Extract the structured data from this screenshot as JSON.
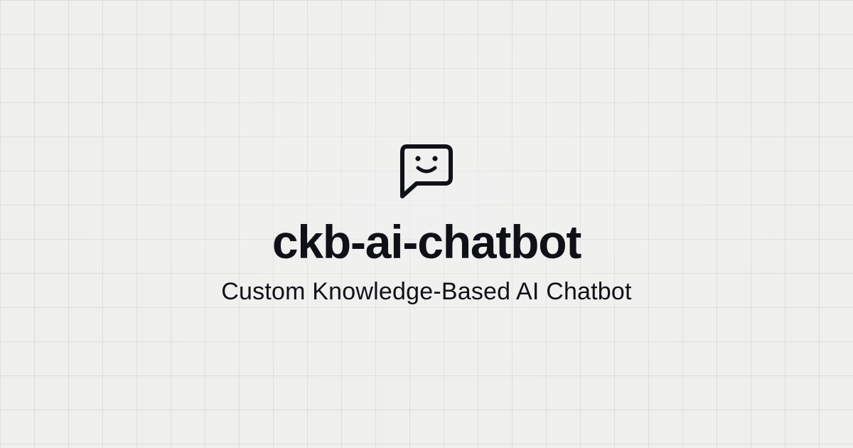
{
  "logo": {
    "icon": "chat-smile-icon",
    "color": "#0f1117"
  },
  "title": "ckb-ai-chatbot",
  "subtitle": "Custom Knowledge-Based AI Chatbot",
  "colors": {
    "background": "#efefee",
    "grid": "#dcdcdb",
    "text": "#0f1117"
  }
}
